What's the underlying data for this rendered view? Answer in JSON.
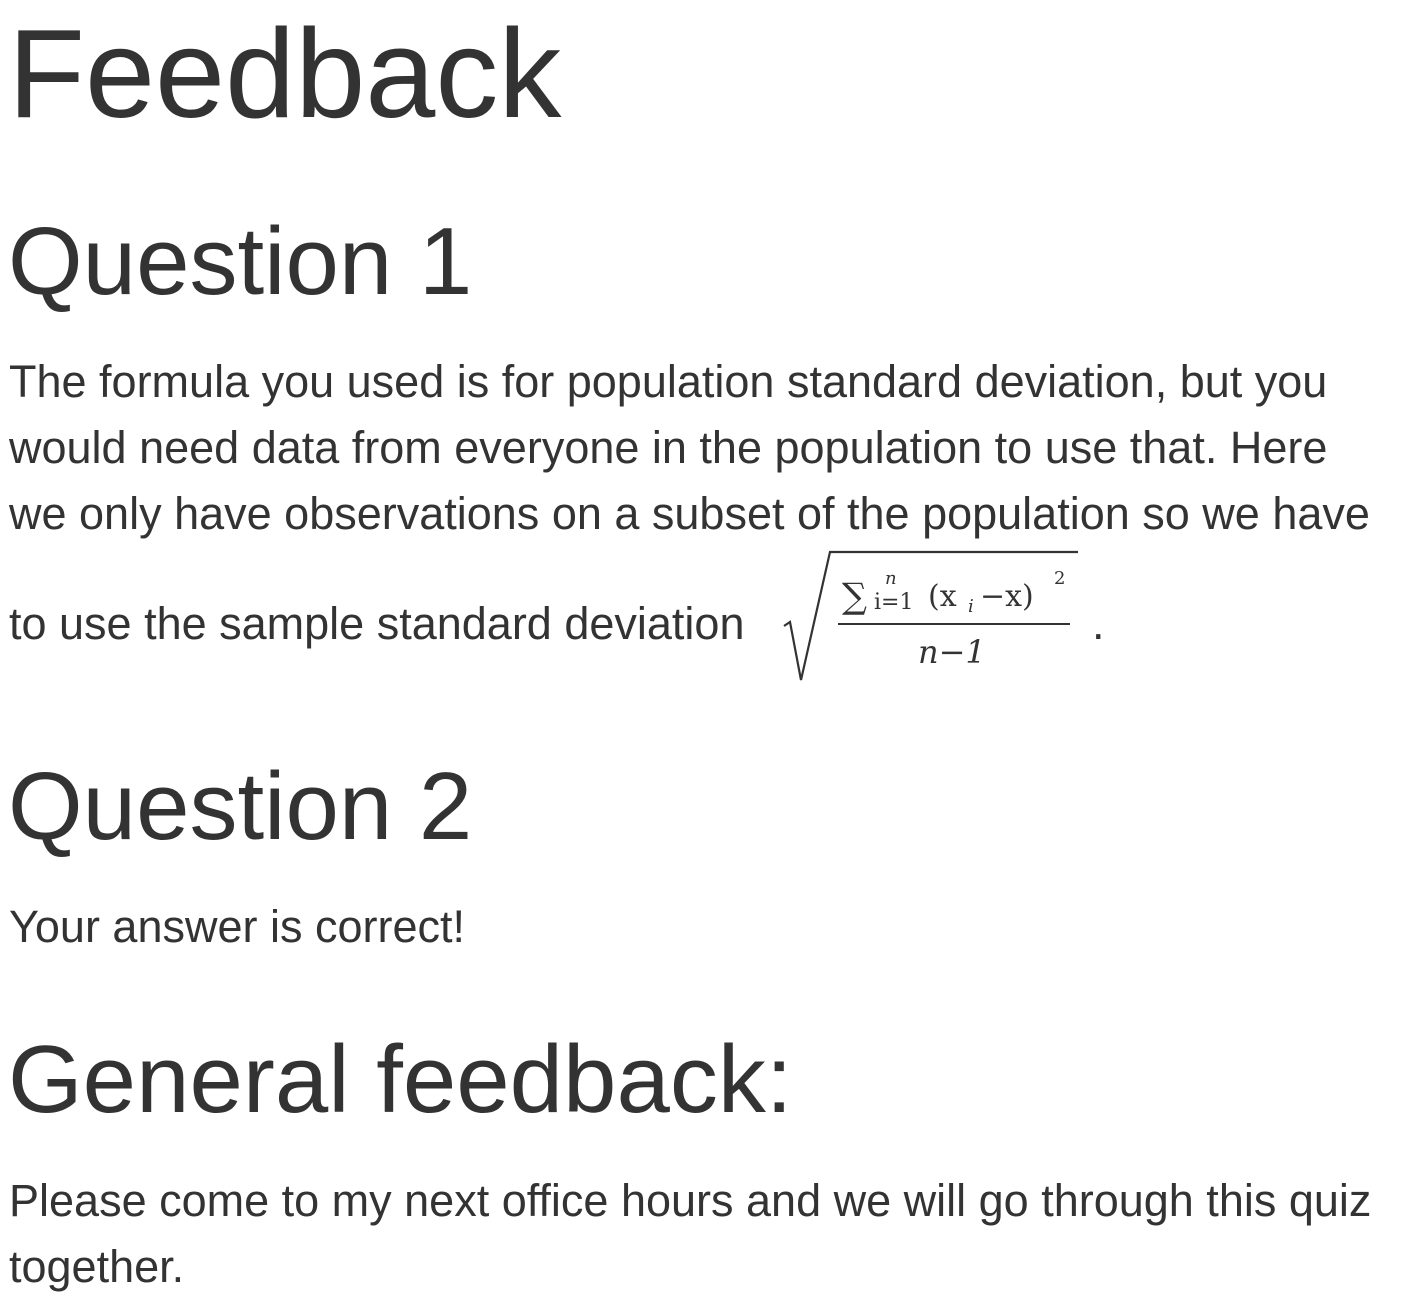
{
  "page": {
    "title": "Feedback"
  },
  "question1": {
    "heading": "Question 1",
    "lines": [
      "The formula you used is for population standard deviation, but you",
      "would need data from everyone in the population to use that. Here",
      "we only have observations on a subset of the population so we have",
      "to use the sample standard deviation"
    ],
    "formula": {
      "sum_symbol": "∑",
      "upper_limit": "n",
      "lower_limit": "i=1",
      "numerator_body": "(x",
      "subscript_i": "i",
      "minus_x": "−x)",
      "exponent": "2",
      "denominator": "n−1",
      "trailing_period": "."
    }
  },
  "question2": {
    "heading": "Question 2",
    "text": "Your answer is correct!"
  },
  "general": {
    "heading": "General feedback:",
    "lines": [
      "Please come to my next office hours and we will go through this quiz",
      "together."
    ]
  }
}
